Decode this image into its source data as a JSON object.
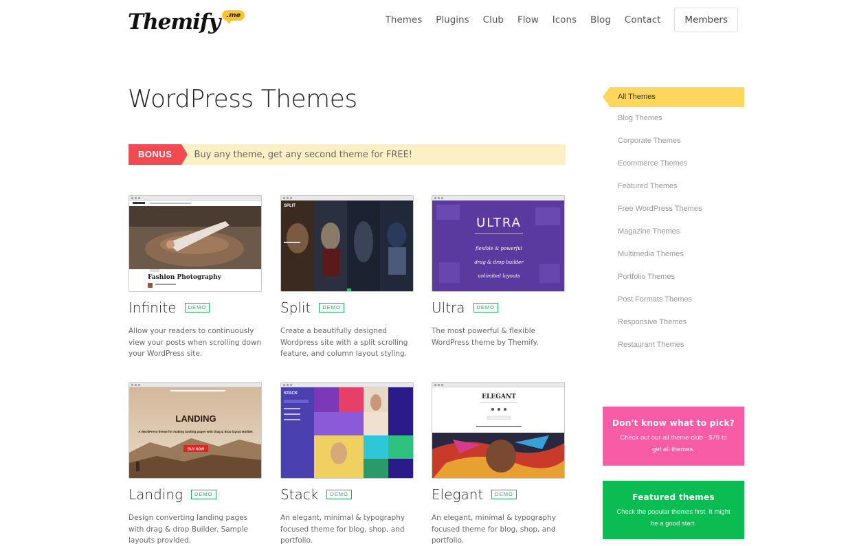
{
  "header": {
    "logo_text": "Themify",
    "logo_badge": ".me",
    "nav": [
      "Themes",
      "Plugins",
      "Club",
      "Flow",
      "Icons",
      "Blog",
      "Contact"
    ],
    "members_label": "Members"
  },
  "main": {
    "title": "WordPress Themes",
    "bonus": {
      "tag": "BONUS",
      "text": "Buy any theme, get any second theme for FREE!"
    },
    "demo_label": "DEMO",
    "themes": [
      {
        "name": "Infinite",
        "description": "Allow your readers to continuously view your posts when scrolling down your WordPress site.",
        "thumb_caption": "Fashion Photography"
      },
      {
        "name": "Split",
        "description": "Create a beautifully designed Wordpress site with a split scrolling feature, and column layout styling.",
        "thumb_caption": "SPLIT"
      },
      {
        "name": "Ultra",
        "description": "The most powerful & flexible WordPress theme by Themify.",
        "thumb_caption": "ULTRA",
        "thumb_lines": [
          "flexible & powerful",
          "drag & drop builder",
          "unlimited layouts"
        ]
      },
      {
        "name": "Landing",
        "description": "Design converting landing pages with drag & drop Builder. Sample layouts provided.",
        "thumb_caption": "LANDING",
        "thumb_subline": "A WordPress theme for making landing pages with drag & drop layout Builder.",
        "thumb_button": "BUY NOW"
      },
      {
        "name": "Stack",
        "description": "An elegant, minimal & typography focused theme for blog, shop, and portfolio.",
        "thumb_caption": "STACK"
      },
      {
        "name": "Elegant",
        "description": "An elegant, minimal & typography focused theme for blog, shop, and portfolio.",
        "thumb_caption": "ELEGANT"
      }
    ]
  },
  "sidebar": {
    "active": "All Themes",
    "items": [
      "Blog Themes",
      "Corporate Themes",
      "Ecommerce Themes",
      "Featured Themes",
      "Free WordPress Themes",
      "Magazine Themes",
      "Multimedia Themes",
      "Portfolio Themes",
      "Post Formats Themes",
      "Responsive Themes",
      "Restaurant Themes"
    ],
    "promo_pick": {
      "title": "Don't know what to pick?",
      "text": "Check out our all theme club - $79 to get all themes."
    },
    "promo_featured": {
      "title": "Featured themes",
      "text": "Check the popular themes first. It might be a good start."
    }
  },
  "colors": {
    "accent_yellow": "#fdd65c",
    "bonus_red": "#f24a50",
    "demo_green": "#26b35c",
    "promo_pink": "#f95ca7",
    "promo_green": "#0bbc52"
  }
}
